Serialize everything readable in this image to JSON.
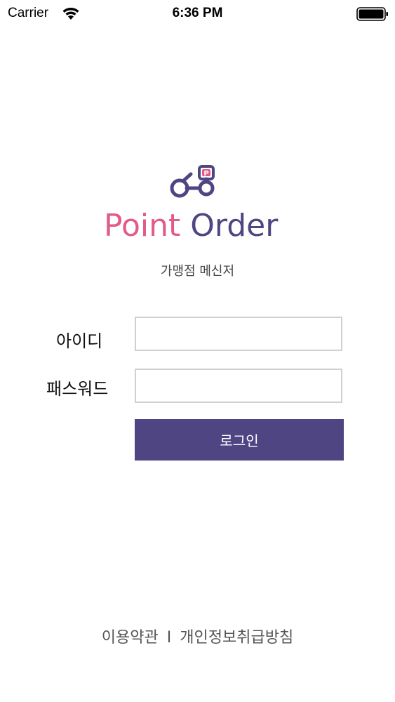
{
  "status_bar": {
    "carrier": "Carrier",
    "time": "6:36 PM"
  },
  "logo": {
    "badge_letter": "P",
    "word_point": "Point",
    "word_order": "Order",
    "colors": {
      "pink": "#e25a8a",
      "purple": "#4f4582"
    }
  },
  "subtitle": "가맹점 메신저",
  "form": {
    "id_label": "아이디",
    "id_value": "",
    "password_label": "패스워드",
    "password_value": "",
    "login_label": "로그인"
  },
  "footer": {
    "terms": "이용약관",
    "separator": "I",
    "privacy": "개인정보취급방침"
  }
}
